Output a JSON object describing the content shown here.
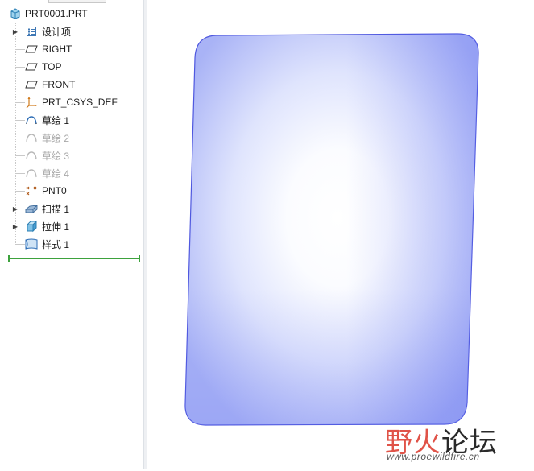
{
  "model_tree": {
    "root_label": "PRT0001.PRT",
    "items": [
      {
        "label": "设计项",
        "icon": "layer-list-icon",
        "expandable": true,
        "dim": false
      },
      {
        "label": "RIGHT",
        "icon": "datum-plane-icon",
        "expandable": false,
        "dim": false
      },
      {
        "label": "TOP",
        "icon": "datum-plane-icon",
        "expandable": false,
        "dim": false
      },
      {
        "label": "FRONT",
        "icon": "datum-plane-icon",
        "expandable": false,
        "dim": false
      },
      {
        "label": "PRT_CSYS_DEF",
        "icon": "coordinate-system-icon",
        "expandable": false,
        "dim": false
      },
      {
        "label": "草绘 1",
        "icon": "sketch-icon",
        "expandable": false,
        "dim": false
      },
      {
        "label": "草绘 2",
        "icon": "sketch-icon",
        "expandable": false,
        "dim": true
      },
      {
        "label": "草绘 3",
        "icon": "sketch-icon",
        "expandable": false,
        "dim": true
      },
      {
        "label": "草绘 4",
        "icon": "sketch-icon",
        "expandable": false,
        "dim": true
      },
      {
        "label": "PNT0",
        "icon": "datum-point-icon",
        "expandable": false,
        "dim": false
      },
      {
        "label": "扫描 1",
        "icon": "sweep-icon",
        "expandable": true,
        "dim": false
      },
      {
        "label": "拉伸 1",
        "icon": "extrude-icon",
        "expandable": true,
        "dim": false
      },
      {
        "label": "样式 1",
        "icon": "style-surface-icon",
        "expandable": false,
        "dim": false
      }
    ]
  },
  "watermark": {
    "logo_red": "野火",
    "logo_dark": "论坛",
    "url": "www.proewildfire.cn"
  },
  "colors": {
    "surface_edge": "#5a63e6",
    "surface_light": "#ffffff",
    "surface_shade": "#a7b2f6",
    "insert_marker": "#3da23d",
    "watermark_red": "#e05348"
  }
}
